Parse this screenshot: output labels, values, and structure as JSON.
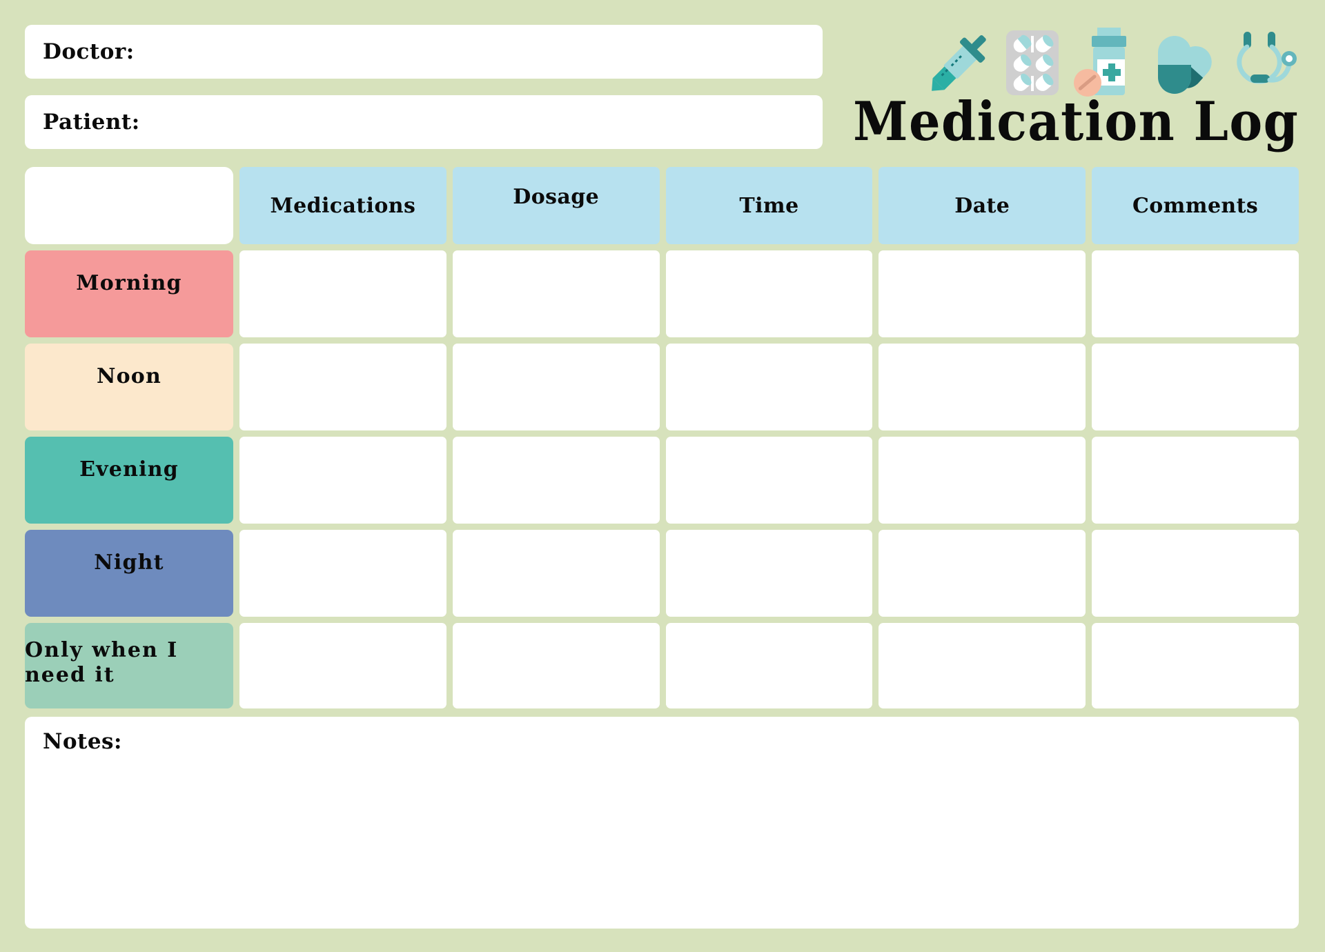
{
  "document": {
    "title": "Medication Log",
    "background_color": "#D7E2BC"
  },
  "fields": {
    "doctor_label": "Doctor:",
    "doctor_value": "",
    "patient_label": "Patient:",
    "patient_value": ""
  },
  "icons": [
    {
      "name": "syringe-icon"
    },
    {
      "name": "pill-blister-pack-icon"
    },
    {
      "name": "medicine-bottle-icon"
    },
    {
      "name": "capsules-icon"
    },
    {
      "name": "stethoscope-icon"
    }
  ],
  "table": {
    "corner_label": "",
    "header_bg": "#B7E1EF",
    "columns": [
      {
        "label": "Medications"
      },
      {
        "label": "Dosage"
      },
      {
        "label": "Time"
      },
      {
        "label": "Date"
      },
      {
        "label": "Comments"
      }
    ],
    "rows": [
      {
        "label": "Morning",
        "color": "#F59A9A",
        "cells": [
          "",
          "",
          "",
          "",
          ""
        ]
      },
      {
        "label": "Noon",
        "color": "#FCE8CC",
        "cells": [
          "",
          "",
          "",
          "",
          ""
        ]
      },
      {
        "label": "Evening",
        "color": "#55BFB0",
        "cells": [
          "",
          "",
          "",
          "",
          ""
        ]
      },
      {
        "label": "Night",
        "color": "#6E8BBE",
        "cells": [
          "",
          "",
          "",
          "",
          ""
        ]
      },
      {
        "label": "Only when I need it",
        "color": "#9BCFB8",
        "cells": [
          "",
          "",
          "",
          "",
          ""
        ]
      }
    ]
  },
  "notes": {
    "label": "Notes:",
    "value": ""
  }
}
